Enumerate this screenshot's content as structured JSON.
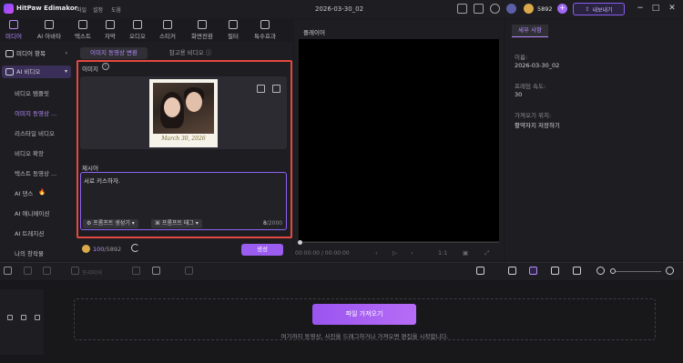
{
  "app": {
    "name": "HitPaw Edimakor",
    "menu": [
      "파일",
      "설정",
      "도움"
    ],
    "document_title": "2026-03-30_02",
    "credits": "5892",
    "export_label": "내보내기"
  },
  "toolbar": {
    "items": [
      {
        "label": "미디어",
        "icon": "media-icon",
        "active": true
      },
      {
        "label": "AI 아바타",
        "icon": "avatar-icon",
        "active": false
      },
      {
        "label": "텍스트",
        "icon": "text-icon",
        "active": false
      },
      {
        "label": "자막",
        "icon": "subtitle-icon",
        "active": false
      },
      {
        "label": "오디오",
        "icon": "audio-icon",
        "active": false
      },
      {
        "label": "스티커",
        "icon": "sticker-icon",
        "active": false
      },
      {
        "label": "화면전환",
        "icon": "transition-icon",
        "active": false
      },
      {
        "label": "필터",
        "icon": "filter-icon",
        "active": false
      },
      {
        "label": "특수효과",
        "icon": "effects-icon",
        "active": false
      }
    ]
  },
  "sidebar": {
    "top_items": [
      "미디어 항목",
      "AI 비디오"
    ],
    "sub_items": [
      "비디오 템플릿",
      "이미지 동영상 ...",
      "리스타일 비디오",
      "비디오 확장",
      "텍스트 동영상 ...",
      "AI 댄스",
      "AI 애니메이션",
      "AI 트레지션",
      "나의 창작물"
    ],
    "selected_sub": "이미지 동영상 ..."
  },
  "panel": {
    "tabs": [
      "이미지 동영상 변환",
      "참고용 비디오 ⓘ"
    ],
    "image_label": "이미지",
    "photo_caption": "March 30, 2026",
    "prompt_label": "제시어",
    "prompt_value": "서로 키스하자.",
    "prompt_pill_1": "프롬프트 생성기",
    "prompt_pill_2": "프롬프트 태그",
    "prompt_count": "8",
    "prompt_max": "/2000",
    "credits_used": "100",
    "credits_total": "/5892",
    "generate_label": "생성"
  },
  "player": {
    "title": "플레이어",
    "time_current": "00:00:00",
    "time_total": "/ 00:00:00",
    "ratio": "1:1"
  },
  "properties": {
    "tab": "세부 사항",
    "name_key": "이름:",
    "name_val": "2026-03-30_02",
    "fps_key": "프레임 속도:",
    "fps_val": "30",
    "location_key": "가져오기 위치:",
    "location_val": "활약자지 저장하기"
  },
  "timeline": {
    "split_label": "프리미어",
    "import_label": "파일 가져오기",
    "hint": "여기까지 동영상, 사진을 드래그하거나 가져오면 편집을 시작합니다."
  },
  "colors": {
    "accent": "#b78cff",
    "highlight_box": "#e5483f",
    "button": "#9b5cf0"
  }
}
